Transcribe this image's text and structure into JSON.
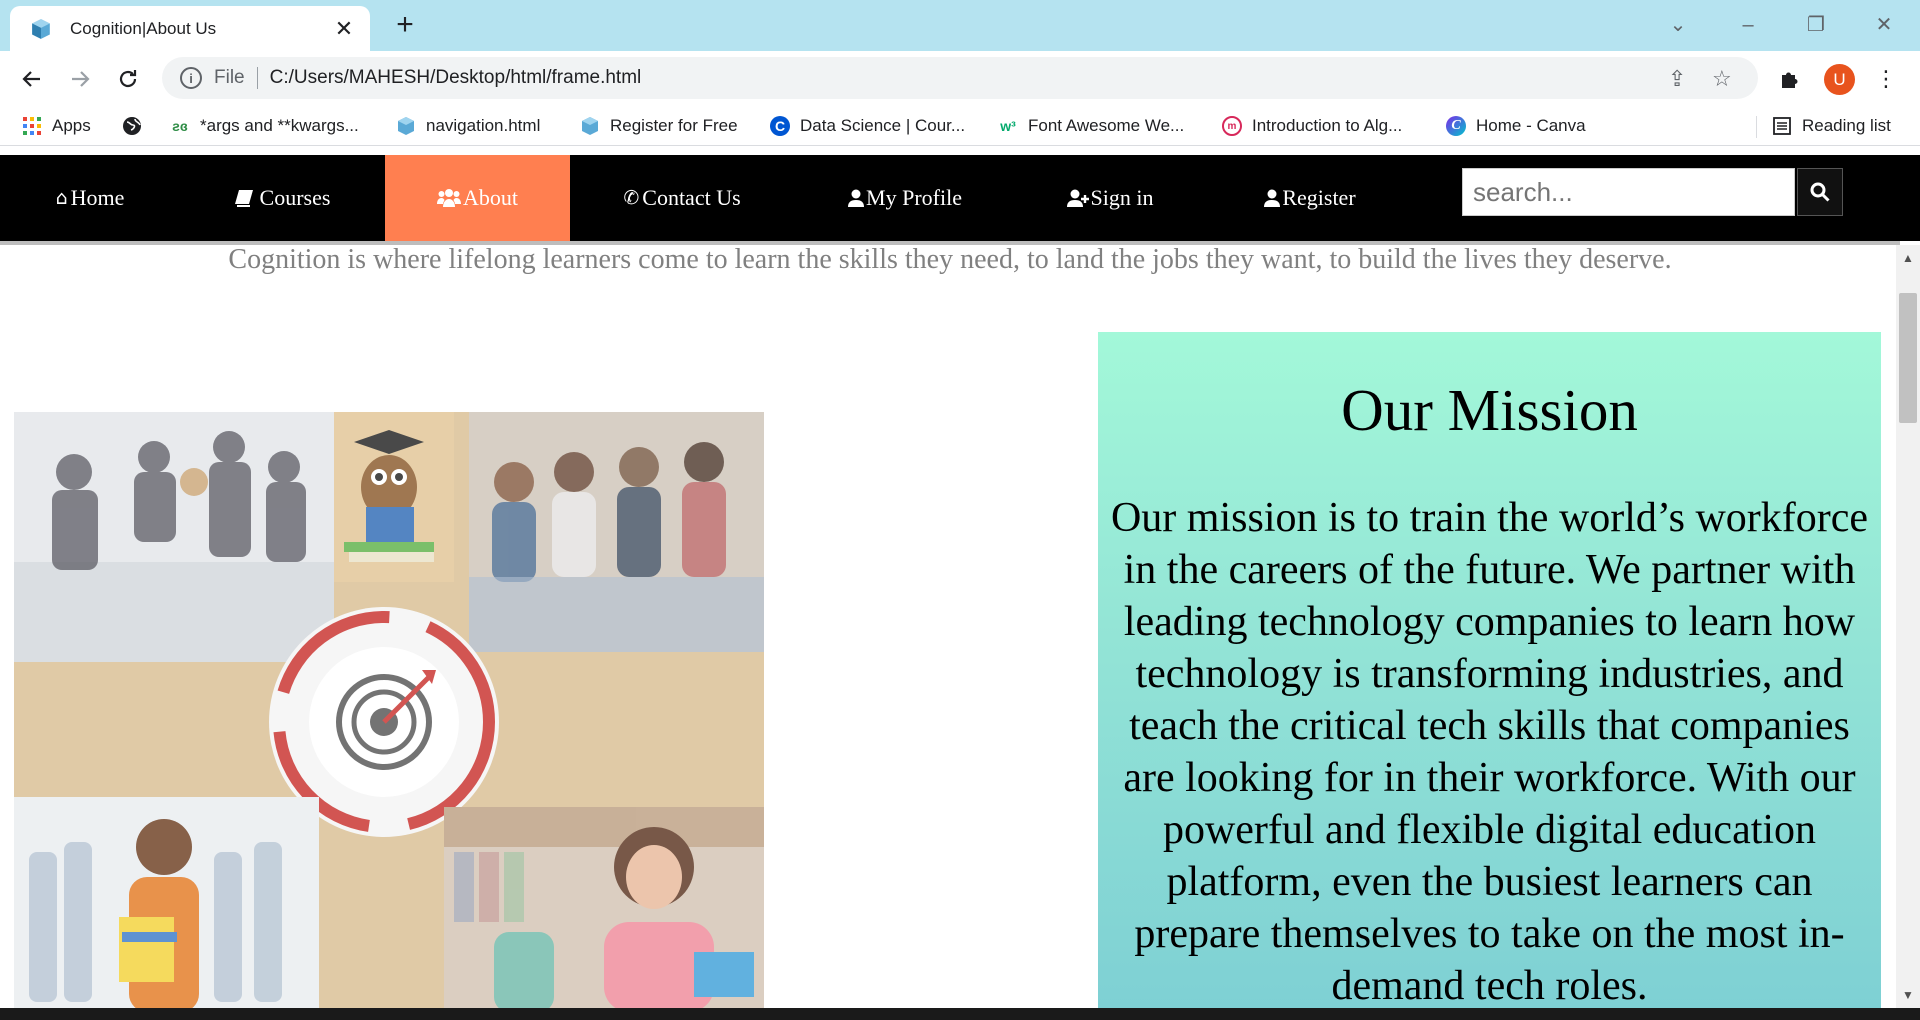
{
  "browser": {
    "tab": {
      "title": "Cognition|About Us",
      "close_icon": "✕"
    },
    "new_tab_icon": "+",
    "window_controls": {
      "chevron": "⌄",
      "minimize": "–",
      "restore": "❐",
      "close": "✕"
    },
    "address": {
      "scheme_label": "File",
      "url": "C:/Users/MAHESH/Desktop/html/frame.html"
    },
    "avatar_letter": "U",
    "bookmarks": [
      {
        "label": "Apps",
        "icon": "apps-grid-icon"
      },
      {
        "label": "",
        "icon": "globe-icon"
      },
      {
        "label": "*args and **kwargs...",
        "icon": "geeksforgeeks-icon"
      },
      {
        "label": "navigation.html",
        "icon": "cube-icon"
      },
      {
        "label": "Register for Free",
        "icon": "cube-icon"
      },
      {
        "label": "Data Science | Cour...",
        "icon": "coursera-icon"
      },
      {
        "label": "Font Awesome We...",
        "icon": "w3schools-icon"
      },
      {
        "label": "Introduction to Alg...",
        "icon": "mit-icon"
      },
      {
        "label": "Home - Canva",
        "icon": "canva-icon"
      }
    ],
    "reading_list": "Reading list"
  },
  "site": {
    "nav": [
      {
        "label": "Home",
        "icon": "home-icon"
      },
      {
        "label": "Courses",
        "icon": "book-icon"
      },
      {
        "label": "About",
        "icon": "users-icon",
        "active": true
      },
      {
        "label": "Contact Us",
        "icon": "phone-icon"
      },
      {
        "label": "My Profile",
        "icon": "user-icon"
      },
      {
        "label": "Sign in",
        "icon": "user-plus-icon"
      },
      {
        "label": "Register",
        "icon": "user-icon"
      }
    ],
    "search_placeholder": "search...",
    "tagline": "Cognition is where lifelong learners come to learn the skills they need, to land the jobs they want, to build the lives they deserve.",
    "mission": {
      "heading": "Our Mission",
      "body": "Our mission is to train the world’s workforce in the careers of the future. We partner with leading technology companies to learn how technology is transforming industries, and teach the critical tech skills that companies are looking for in their workforce. With our powerful and flexible digital education platform, even the busiest learners can prepare themselves to take on the most in-demand tech roles."
    }
  },
  "colors": {
    "nav_bg": "#000000",
    "nav_active": "#ff7f50",
    "tabstrip": "#b5e3f0",
    "mission_top": "#a3f8d9",
    "mission_bottom": "#7ed0d4"
  }
}
